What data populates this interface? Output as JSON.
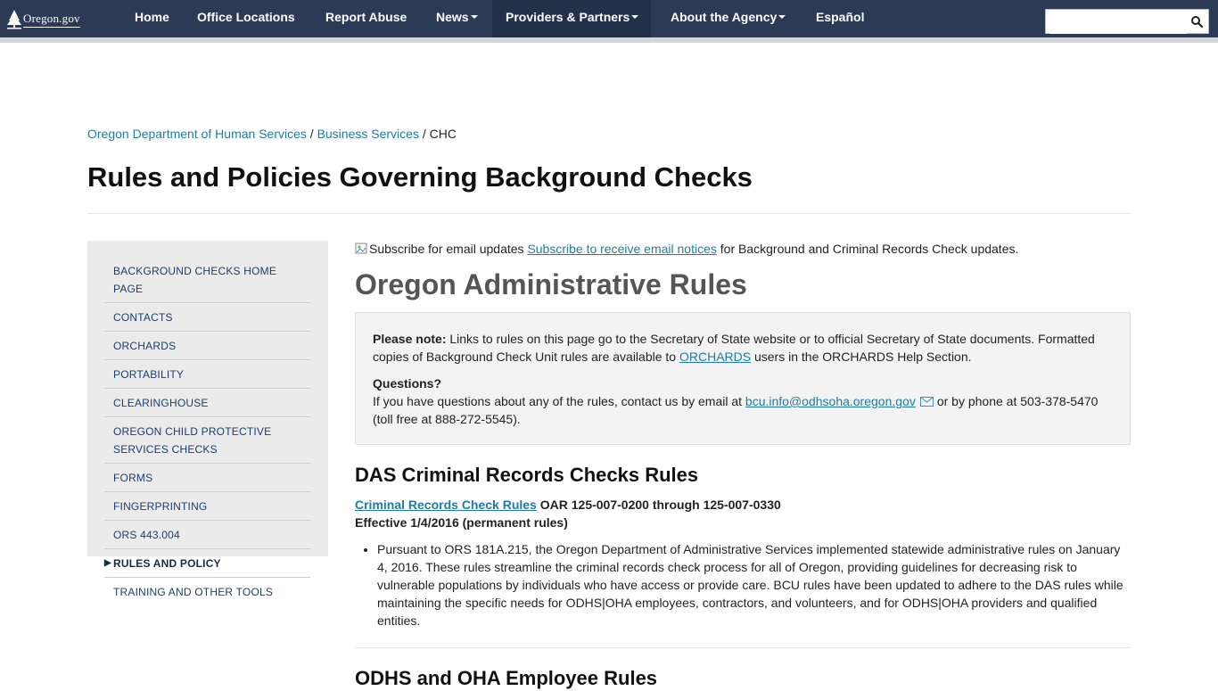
{
  "nav": {
    "logo_text": "Oregon.gov",
    "items": [
      {
        "label": "Home",
        "dropdown": false
      },
      {
        "label": "Office Locations",
        "dropdown": false
      },
      {
        "label": "Report Abuse",
        "dropdown": false
      },
      {
        "label": "News",
        "dropdown": true
      },
      {
        "label": "Providers & Partners",
        "dropdown": true
      },
      {
        "label": "About the Agency",
        "dropdown": true
      },
      {
        "label": "Español",
        "dropdown": false
      }
    ],
    "search_value": ""
  },
  "breadcrumb": {
    "items": [
      "Oregon Department of Human Services",
      "Business Services"
    ],
    "separator": "/",
    "current": "CHC"
  },
  "page_title": "Rules and Policies Governing Background Checks",
  "sidebar": {
    "items": [
      "BACKGROUND CHECKS HOME PAGE",
      "CONTACTS",
      "ORCHARDS",
      "PORTABILITY",
      "CLEARINGHOUSE",
      "OREGON CHILD PROTECTIVE SERVICES CHECKS",
      "FORMS",
      "FINGERPRINTING",
      "ORS 443.004",
      "RULES AND POLICY",
      "TRAINING AND OTHER TOOLS"
    ],
    "current_marker": "▶"
  },
  "main": {
    "subscribe_img_alt": "Subscribe for email updates",
    "subscribe_link": "Subscribe to receive email notices",
    "subscribe_rest": " for Background and Criminal Records Check updates.",
    "heading": "Oregon Administrative Rules",
    "note": {
      "label": "Please note:",
      "text_1": " Links to rules on this page go to the Secretary of State website or to official Secretary of State documents. Formatted copies of Background Check Unit rules are available to ",
      "link": "ORCHARDS",
      "text_2": " users in the ORCHARDS Help Section.",
      "questions_label": "Questions?",
      "questions_text": "If you have questions about any of the rules, contact us by email at ",
      "email": "bcu.info@odhsoha.oregon.gov",
      "questions_text_2": "or by phone at 503-378-5470 (toll free at 888-272-5545)."
    },
    "das_heading": "DAS Criminal Records Checks Rules",
    "das_link": "Criminal Records Check Rules",
    "das_oar": " OAR 125-007-0200 through 125-007-0330",
    "das_effective": "Effective 1/4/2016 (permanent rules)",
    "das_bullet": "Pursuant to ORS 181A.215, the Oregon Department of Administrative Services implemented statewide administrative rules on January 4, 2016. These rules streamline the criminal records check process for all of Oregon, providing guidelines for decreasing risk to vulnerable populations by individuals who have access or provide care. BCU rules have been updated to adhere to the DAS rules while maintaining the specific needs for ODHS|OHA employees, contractors, and volunteers, and for ODHS|OHA providers and qualified entities.",
    "next_heading": "ODHS and OHA Employee Rules"
  }
}
